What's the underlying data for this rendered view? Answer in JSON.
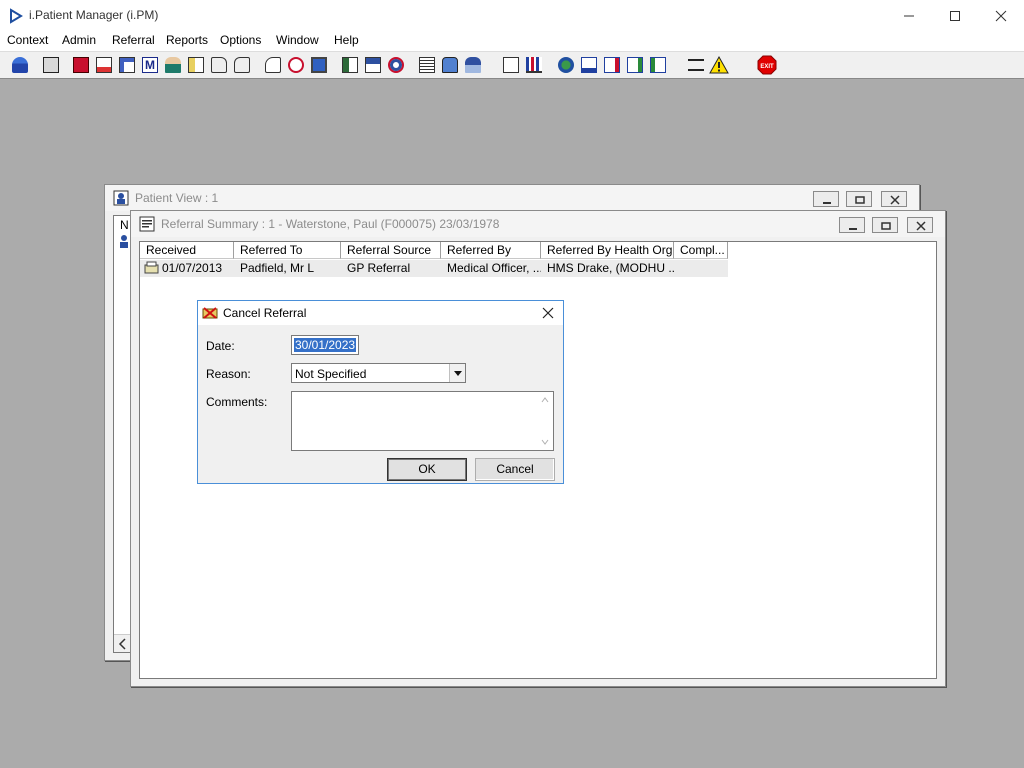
{
  "app": {
    "title": "i.Patient Manager (i.PM)"
  },
  "menu": [
    "Context",
    "Admin",
    "Referral",
    "Reports",
    "Options",
    "Window",
    "Help"
  ],
  "toolbar": {
    "icons": [
      "patient-icon",
      "print-icon",
      "book-icon",
      "edit-note-icon",
      "find-icon",
      "mail-m-icon",
      "nurse-icon",
      "notes-icon",
      "ambulance-icon",
      "transport-icon",
      "search-doc-icon",
      "clock-icon",
      "monitor-icon",
      "photo-card-icon",
      "card-icon",
      "time-dial-icon",
      "list-icon",
      "bed-icon",
      "person-bed-icon",
      "blank-page-icon",
      "bar-chart-icon",
      "globe-icon",
      "checklist-icon",
      "checklist2-icon",
      "checklist3-icon",
      "checklist4-icon",
      "swap-icon",
      "warning-icon",
      "exit-icon"
    ]
  },
  "patient_view": {
    "title": "Patient View : 1",
    "partial_col": "N"
  },
  "referral_summary": {
    "title": "Referral Summary : 1 - Waterstone, Paul (F000075) 23/03/1978",
    "columns": [
      "Received",
      "Referred To",
      "Referral Source",
      "Referred By",
      "Referred By Health Org.",
      "Compl..."
    ],
    "rows": [
      {
        "received": "01/07/2013",
        "referred_to": "Padfield, Mr L",
        "source": "GP Referral",
        "referred_by": "Medical Officer, ...",
        "health_org": "HMS Drake, (MODHU ...",
        "compl": ""
      }
    ]
  },
  "cancel_dialog": {
    "title": "Cancel Referral",
    "date_label": "Date:",
    "date_value": "30/01/2023",
    "reason_label": "Reason:",
    "reason_value": "Not Specified",
    "comments_label": "Comments:",
    "comments_value": "",
    "ok_label": "OK",
    "cancel_label": "Cancel"
  }
}
